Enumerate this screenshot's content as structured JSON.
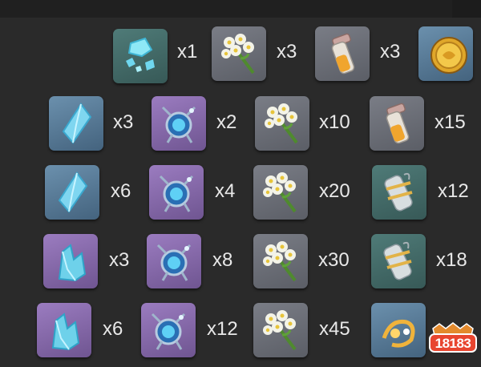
{
  "background_color": "#2a2a2a",
  "text_color": "#e8e8e8",
  "watermark": {
    "text": "18183",
    "icon": "18183-logo"
  },
  "rows": [
    {
      "items": [
        {
          "icon": "crystal-chunk-icon",
          "bg": "green",
          "qty": "x1"
        },
        {
          "icon": "flower-bouquet-icon",
          "bg": "gray",
          "qty": "x3"
        },
        {
          "icon": "potion-vial-icon",
          "bg": "gray",
          "qty": "x3"
        },
        {
          "icon": "gold-coin-icon",
          "bg": "blue",
          "qty": ""
        }
      ]
    },
    {
      "items": [
        {
          "icon": "crystal-shard-icon",
          "bg": "blue",
          "qty": "x3"
        },
        {
          "icon": "arcane-orb-icon",
          "bg": "purple",
          "qty": "x2"
        },
        {
          "icon": "flower-bouquet-icon",
          "bg": "gray",
          "qty": "x10"
        },
        {
          "icon": "potion-vial-icon",
          "bg": "gray",
          "qty": "x15"
        }
      ]
    },
    {
      "items": [
        {
          "icon": "crystal-shard-icon",
          "bg": "blue",
          "qty": "x6"
        },
        {
          "icon": "arcane-orb-icon",
          "bg": "purple",
          "qty": "x4"
        },
        {
          "icon": "flower-bouquet-icon",
          "bg": "gray",
          "qty": "x20"
        },
        {
          "icon": "wrapped-scroll-icon",
          "bg": "green",
          "qty": "x12"
        }
      ]
    },
    {
      "items": [
        {
          "icon": "crystal-cluster-icon",
          "bg": "purple",
          "qty": "x3"
        },
        {
          "icon": "arcane-orb-icon",
          "bg": "purple",
          "qty": "x8"
        },
        {
          "icon": "flower-bouquet-icon",
          "bg": "gray",
          "qty": "x30"
        },
        {
          "icon": "wrapped-scroll-icon",
          "bg": "green",
          "qty": "x18"
        }
      ]
    },
    {
      "items": [
        {
          "icon": "crystal-cluster-icon",
          "bg": "purple",
          "qty": "x6"
        },
        {
          "icon": "arcane-orb-icon",
          "bg": "purple",
          "qty": "x12"
        },
        {
          "icon": "flower-bouquet-icon",
          "bg": "gray",
          "qty": "x45"
        },
        {
          "icon": "golden-scroll-icon",
          "bg": "blue",
          "qty": ""
        }
      ]
    }
  ]
}
